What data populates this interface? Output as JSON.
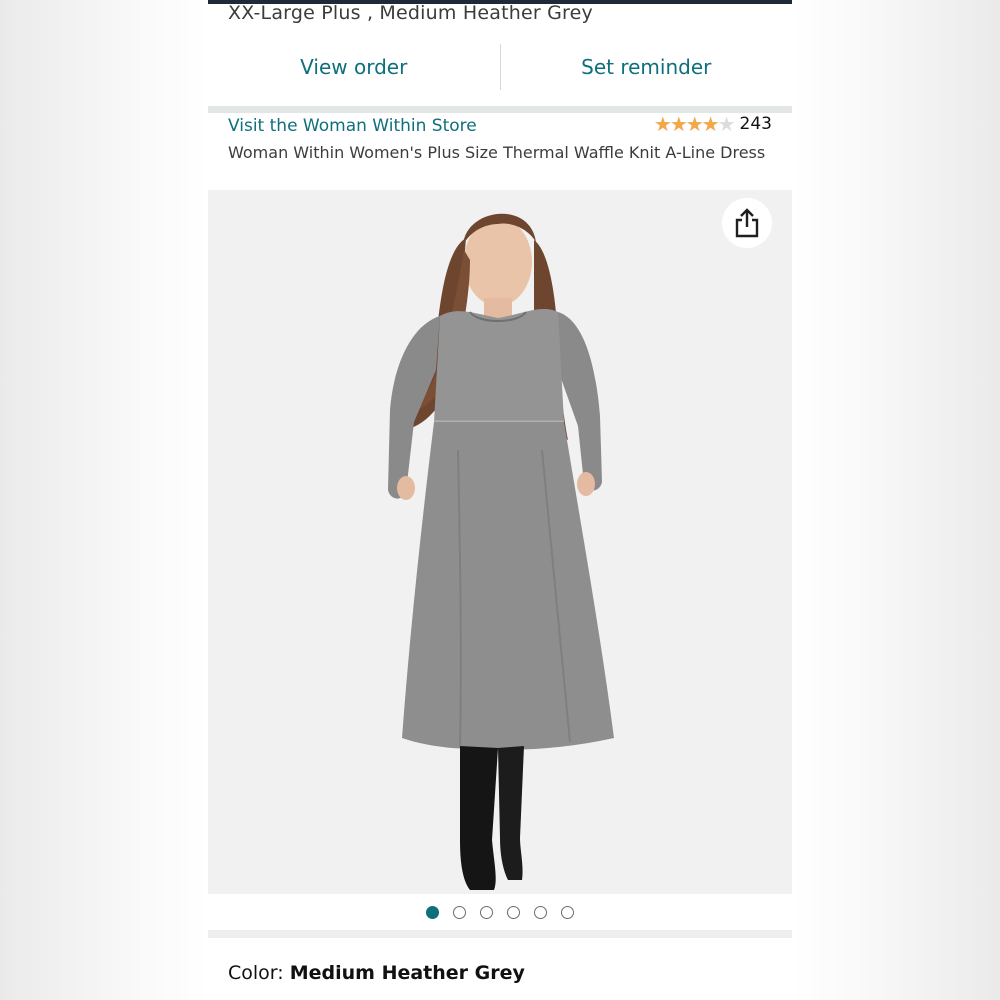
{
  "order_info": {
    "variant": "XX-Large Plus , Medium Heather Grey"
  },
  "actions": {
    "view_order": "View order",
    "set_reminder": "Set reminder"
  },
  "product": {
    "store_link": "Visit the Woman Within Store",
    "rating_stars": 4.0,
    "rating_count": "243",
    "title": "Woman Within Women's Plus Size Thermal Waffle Knit A-Line Dress",
    "image_count": 6,
    "active_image_index": 0
  },
  "color": {
    "label": "Color: ",
    "value": "Medium Heather Grey"
  },
  "colors": {
    "link": "#0e6f7d",
    "star": "#f3a847",
    "dress": "#8e8e8e"
  },
  "icons": {
    "share": "share-icon",
    "star": "star-icon"
  }
}
